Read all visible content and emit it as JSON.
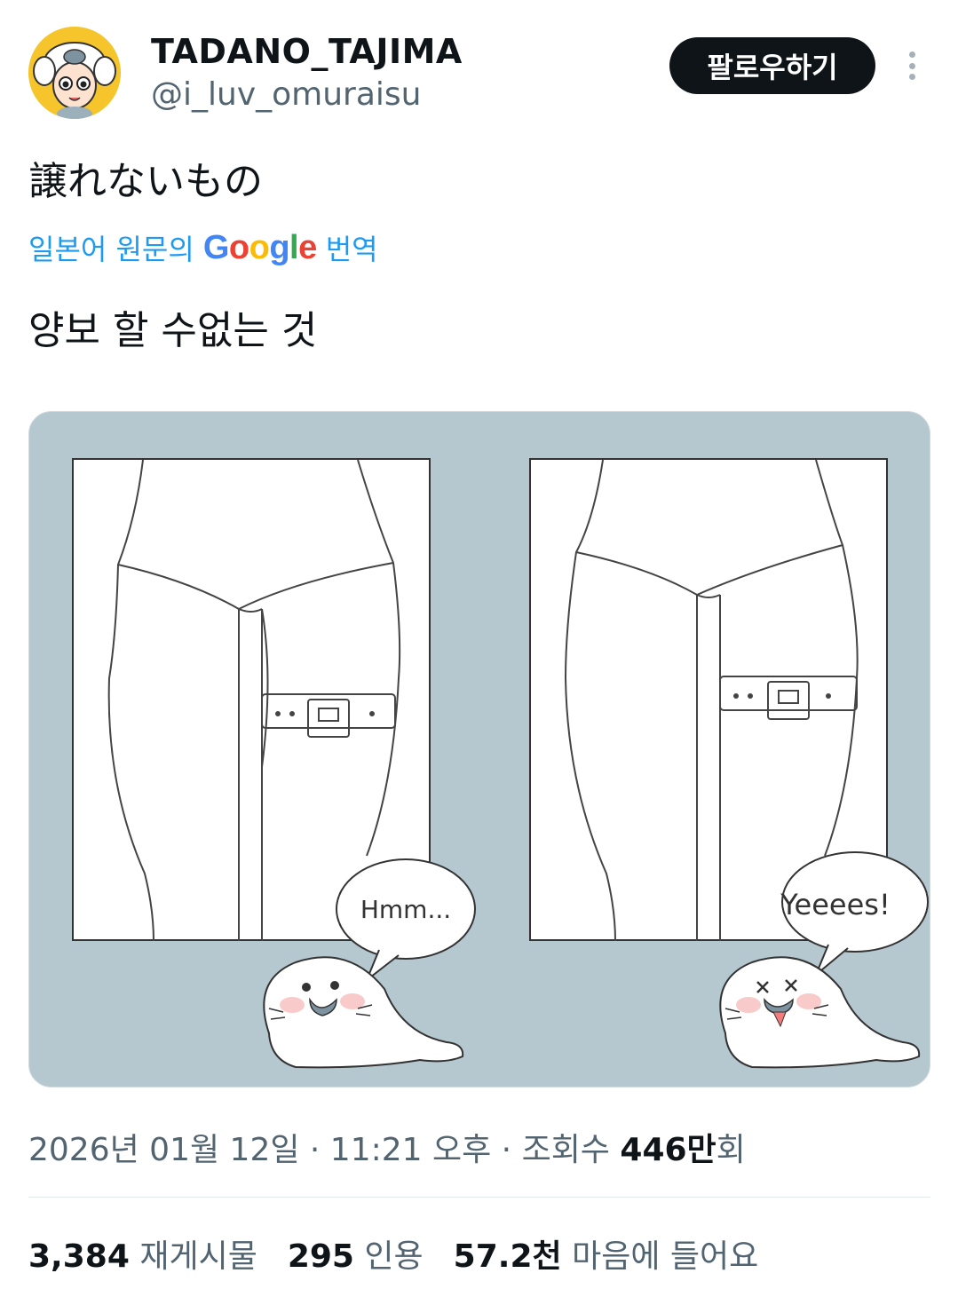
{
  "author": {
    "display_name": "TADANO_TAJIMA",
    "handle": "@i_luv_omuraisu"
  },
  "actions": {
    "follow_label": "팔로우하기"
  },
  "tweet": {
    "text": "譲れないもの",
    "translate": {
      "prefix": "일본어 원문의",
      "provider": "Google",
      "suffix": "번역"
    },
    "translated_text": "양보 할 수없는 것"
  },
  "media": {
    "left_bubble": "Hmm...",
    "right_bubble": "Yeeees!"
  },
  "meta": {
    "datetime": "2026년 01월 12일 · 11:21 오후 · 조회수",
    "views_number": "446만",
    "views_suffix": "회"
  },
  "stats": [
    {
      "number": "3,384",
      "label": "재게시물"
    },
    {
      "number": "295",
      "label": "인용"
    },
    {
      "number": "57.2천",
      "label": "마음에 들어요"
    }
  ],
  "colors": {
    "accent": "#1d9bf0",
    "media_background": "#b5c7cf",
    "avatar_background": "#f5c52b"
  }
}
